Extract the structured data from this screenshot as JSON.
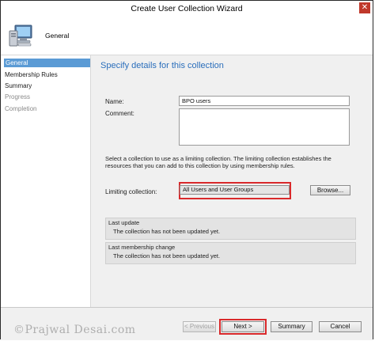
{
  "window": {
    "title": "Create User Collection Wizard",
    "close_glyph": "✕"
  },
  "header": {
    "title": "General"
  },
  "sidebar": {
    "items": [
      {
        "label": "General",
        "state": "active"
      },
      {
        "label": "Membership Rules",
        "state": "enabled"
      },
      {
        "label": "Summary",
        "state": "enabled"
      },
      {
        "label": "Progress",
        "state": "disabled"
      },
      {
        "label": "Completion",
        "state": "disabled"
      }
    ]
  },
  "main": {
    "section_title": "Specify details for this collection",
    "name_label": "Name:",
    "name_value": "BPO users",
    "comment_label": "Comment:",
    "comment_value": "",
    "limiting_description": "Select a collection to use as a limiting collection. The limiting collection establishes the resources that you can add to this collection by using membership rules.",
    "limiting_label": "Limiting collection:",
    "limiting_value": "All Users and User Groups",
    "browse_label": "Browse...",
    "last_update_label": "Last update",
    "last_update_value": "The collection has not been updated yet.",
    "last_change_label": "Last membership change",
    "last_change_value": "The collection has not been updated yet."
  },
  "footer": {
    "previous_label": "< Previous",
    "next_label": "Next >",
    "summary_label": "Summary",
    "cancel_label": "Cancel",
    "watermark": "©Prajwal Desai.com"
  },
  "colors": {
    "accent": "#5b9bd5",
    "title_blue": "#2a6ebb",
    "highlight_red": "#d9292b"
  }
}
